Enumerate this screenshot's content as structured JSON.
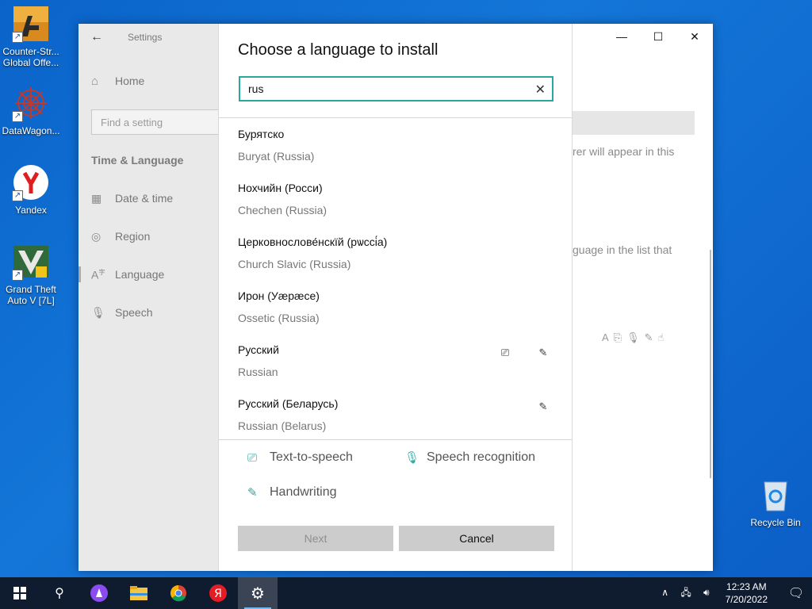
{
  "desktop": {
    "icons": [
      {
        "label": "Counter-Strike Global Offe...",
        "line1": "Counter-Str...",
        "line2": "Global Offe..."
      },
      {
        "label": "DataWagon...",
        "line1": "DataWagon...",
        "line2": ""
      },
      {
        "label": "Yandex",
        "line1": "Yandex",
        "line2": ""
      },
      {
        "label": "Grand Theft Auto V [7L]",
        "line1": "Grand Theft",
        "line2": "Auto V [7L]"
      }
    ],
    "recycle_bin": "Recycle Bin"
  },
  "settings": {
    "title": "Settings",
    "home": "Home",
    "search_placeholder": "Find a setting",
    "section": "Time & Language",
    "nav": [
      {
        "label": "Date & time",
        "icon": "calendar-clock-icon"
      },
      {
        "label": "Region",
        "icon": "globe-icon"
      },
      {
        "label": "Language",
        "icon": "language-icon"
      },
      {
        "label": "Speech",
        "icon": "microphone-icon"
      }
    ],
    "background_text_1": "rer will appear in this",
    "background_text_2": "guage in the list that"
  },
  "dialog": {
    "title": "Choose a language to install",
    "search_value": "rus",
    "languages": [
      {
        "native": "Бурятско",
        "english": "Buryat (Russia)",
        "features": []
      },
      {
        "native": "Нохчийн (Росси)",
        "english": "Chechen (Russia)",
        "features": []
      },
      {
        "native": "Церковнослове́нскїй (рѡссі́а)",
        "english": "Church Slavic (Russia)",
        "features": []
      },
      {
        "native": "Ирон (Уæрæсе)",
        "english": "Ossetic (Russia)",
        "features": []
      },
      {
        "native": "Русский",
        "english": "Russian",
        "features": [
          "text-to-speech",
          "handwriting"
        ]
      },
      {
        "native": "Русский (Беларусь)",
        "english": "Russian (Belarus)",
        "features": [
          "handwriting"
        ]
      }
    ],
    "legend": {
      "tts": "Text-to-speech",
      "speech": "Speech recognition",
      "handwriting": "Handwriting"
    },
    "next_label": "Next",
    "cancel_label": "Cancel"
  },
  "taskbar": {
    "time": "12:23 AM",
    "date": "7/20/2022"
  },
  "colors": {
    "accent": "#2aa89f",
    "desktop": "#0a63c9",
    "taskbar": "#0f1b2e"
  }
}
